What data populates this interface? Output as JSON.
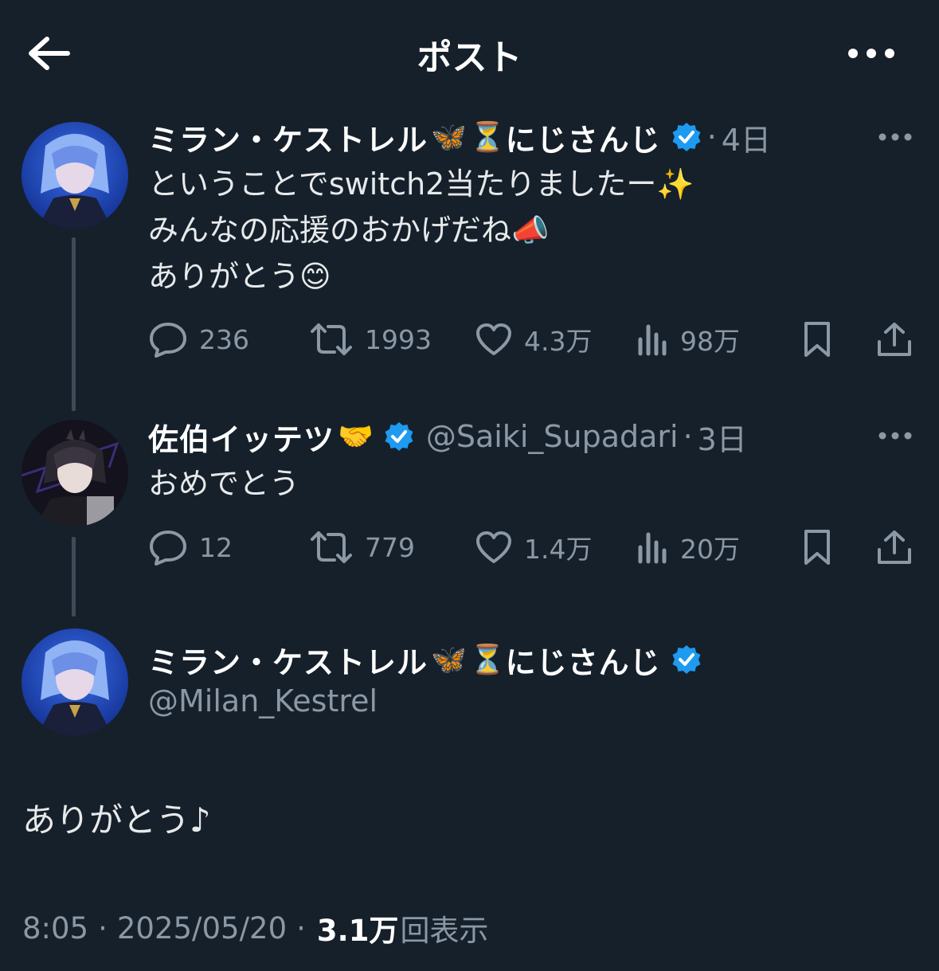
{
  "header": {
    "title": "ポスト"
  },
  "tweets": [
    {
      "display_name": "ミラン・ケストレル",
      "emoji_1": "🦋",
      "emoji_2": "⏳",
      "name_suffix": "にじさんじ",
      "dot": "·",
      "time": "4日",
      "lines": [
        "ということでswitch2当たりましたー✨",
        "みんなの応援のおかげだね📣",
        "ありがとう😊"
      ],
      "stats": {
        "replies": "236",
        "reposts": "1993",
        "likes": "4.3万",
        "views": "98万"
      }
    },
    {
      "display_name": "佐伯イッテツ",
      "emoji_1": "🤝",
      "handle": "@Saiki_Supadari",
      "dot": "·",
      "time": "3日",
      "lines": [
        "おめでとう"
      ],
      "stats": {
        "replies": "12",
        "reposts": "779",
        "likes": "1.4万",
        "views": "20万"
      }
    }
  ],
  "main_post": {
    "display_name": "ミラン・ケストレル",
    "emoji_1": "🦋",
    "emoji_2": "⏳",
    "name_suffix": "にじさんじ",
    "handle": "@Milan_Kestrel",
    "text": "ありがとう♪",
    "time": "8:05",
    "sep1": "·",
    "date": "2025/05/20",
    "sep2": "·",
    "views_count": "3.1万",
    "views_label": "回表示"
  },
  "colors": {
    "background": "#15202b",
    "text": "#e7e9ea",
    "muted": "#8b98a5",
    "verified": "#1d9bf0"
  },
  "icons": {
    "back": "arrow-left-icon",
    "more": "ellipsis-icon",
    "reply": "reply-icon",
    "repost": "repost-icon",
    "like": "heart-icon",
    "views": "analytics-icon",
    "bookmark": "bookmark-icon",
    "share": "share-icon",
    "verified": "verified-badge-icon"
  }
}
